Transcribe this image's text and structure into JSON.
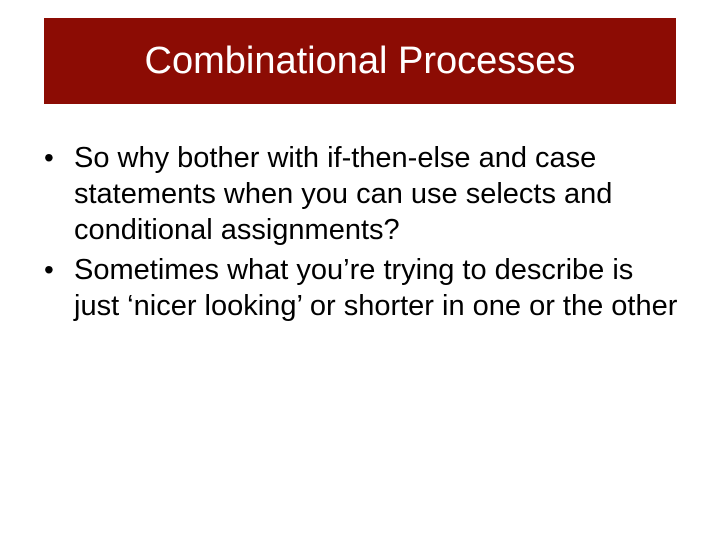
{
  "slide": {
    "title": "Combinational Processes",
    "bullets": [
      "So why bother with if-then-else and case statements when you can use selects and conditional assignments?",
      "Sometimes what you’re trying to describe is just ‘nicer looking’ or shorter in one or the other"
    ]
  }
}
